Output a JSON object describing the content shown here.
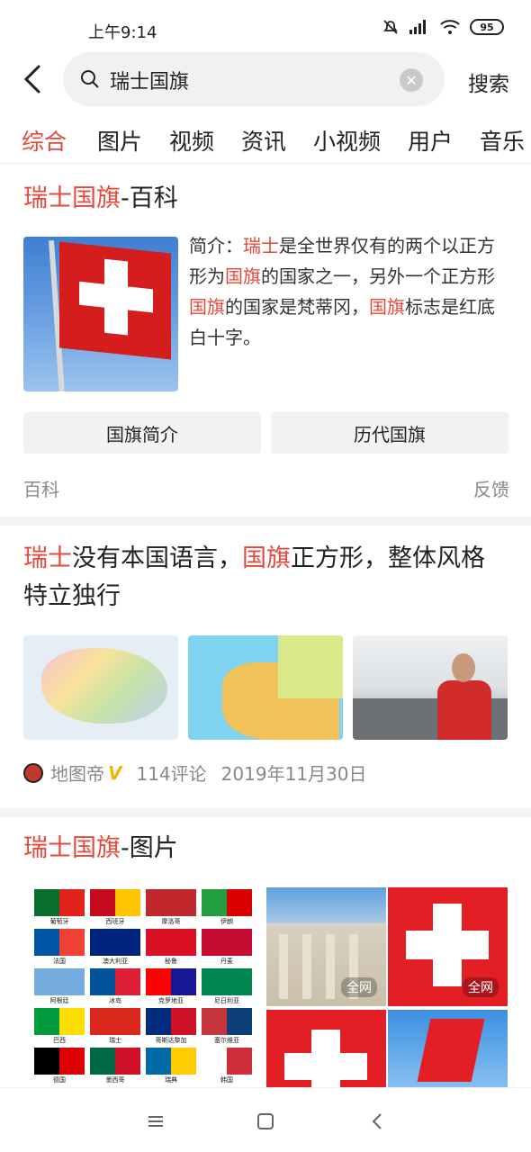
{
  "status": {
    "time": "上午9:14",
    "battery": "95"
  },
  "search": {
    "query": "瑞士国旗",
    "button_label": "搜索"
  },
  "tabs": [
    "综合",
    "图片",
    "视频",
    "资讯",
    "小视频",
    "用户",
    "音乐"
  ],
  "baike": {
    "title_hl": "瑞士国旗",
    "title_rest": "-百科",
    "desc": [
      {
        "t": "简介：",
        "hl": false
      },
      {
        "t": "瑞士",
        "hl": true
      },
      {
        "t": "是全世界仅有的两个以正方形为",
        "hl": false
      },
      {
        "t": "国旗",
        "hl": true
      },
      {
        "t": "的国家之一，另外一个正方形",
        "hl": false
      },
      {
        "t": "国旗",
        "hl": true
      },
      {
        "t": "的国家是梵蒂冈，",
        "hl": false
      },
      {
        "t": "国旗",
        "hl": true
      },
      {
        "t": "标志是红底白十字。",
        "hl": false
      }
    ],
    "buttons": [
      "国旗简介",
      "历代国旗"
    ],
    "source": "百科",
    "feedback": "反馈"
  },
  "news": {
    "title_parts": [
      {
        "t": "瑞士",
        "hl": true
      },
      {
        "t": "没有本国语言，",
        "hl": false
      },
      {
        "t": "国旗",
        "hl": true
      },
      {
        "t": "正方形，整体风格特立独行",
        "hl": false
      }
    ],
    "author": "地图帝",
    "verified": "V",
    "comments": "114评论",
    "date": "2019年11月30日"
  },
  "pictures": {
    "title_hl": "瑞士国旗",
    "title_rest": "-图片",
    "watermark": "全网",
    "flags": [
      {
        "name": "葡萄牙",
        "c1": "#0a6f2e",
        "c2": "#e2231a"
      },
      {
        "name": "西班牙",
        "c1": "#c60b1e",
        "c2": "#ffc400"
      },
      {
        "name": "摩洛哥",
        "c1": "#c1272d",
        "c2": "#c1272d"
      },
      {
        "name": "伊朗",
        "c1": "#239f40",
        "c2": "#da0000"
      },
      {
        "name": "法国",
        "c1": "#0055a4",
        "c2": "#ef4135"
      },
      {
        "name": "澳大利亚",
        "c1": "#00247d",
        "c2": "#00247d"
      },
      {
        "name": "秘鲁",
        "c1": "#d91023",
        "c2": "#d91023"
      },
      {
        "name": "丹麦",
        "c1": "#c60c30",
        "c2": "#c60c30"
      },
      {
        "name": "阿根廷",
        "c1": "#74acdf",
        "c2": "#74acdf"
      },
      {
        "name": "冰岛",
        "c1": "#02529c",
        "c2": "#dc1e35"
      },
      {
        "name": "克罗地亚",
        "c1": "#ff0000",
        "c2": "#171796"
      },
      {
        "name": "尼日利亚",
        "c1": "#008751",
        "c2": "#008751"
      },
      {
        "name": "巴西",
        "c1": "#009c3b",
        "c2": "#ffdf00"
      },
      {
        "name": "瑞士",
        "c1": "#da291c",
        "c2": "#da291c"
      },
      {
        "name": "哥斯达黎加",
        "c1": "#002b7f",
        "c2": "#ce1126"
      },
      {
        "name": "塞尔维亚",
        "c1": "#c6363c",
        "c2": "#0c4076"
      },
      {
        "name": "德国",
        "c1": "#000000",
        "c2": "#dd0000"
      },
      {
        "name": "墨西哥",
        "c1": "#006847",
        "c2": "#ce1126"
      },
      {
        "name": "瑞典",
        "c1": "#006aa7",
        "c2": "#fecc00"
      },
      {
        "name": "韩国",
        "c1": "#ffffff",
        "c2": "#cd2e3a"
      }
    ]
  },
  "colors": {
    "accent": "#e5483a"
  }
}
